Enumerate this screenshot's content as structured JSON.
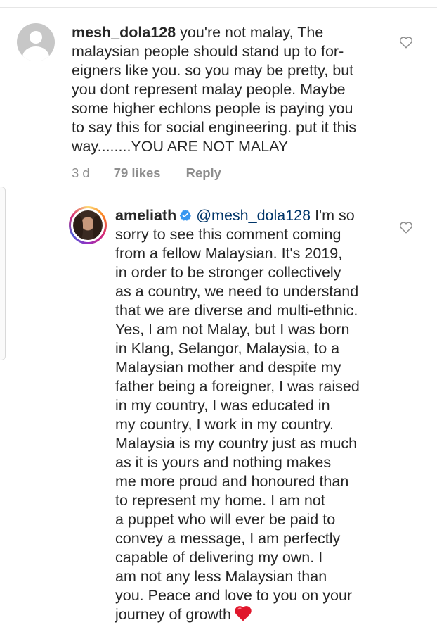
{
  "comments": [
    {
      "username": "mesh_dola128",
      "lines": [
        " you're not malay, The",
        "malaysian people should stand up to for-",
        "eigners like you. so you may be pretty, but",
        "you dont represent malay people. Maybe",
        "some higher echlons people is paying you",
        "to say this for social engineering. put it this",
        "way........YOU ARE NOT MALAY"
      ],
      "time": "3 d",
      "likes": "79 likes",
      "reply_label": "Reply",
      "avatar": "default-avatar-icon",
      "like_icon": "heart-outline-icon"
    },
    {
      "username": "ameliath",
      "verified": true,
      "mention": "@mesh_dola128",
      "first_line_rest": " I'm so",
      "lines": [
        "sorry to see this comment coming",
        "from a fellow Malaysian. It's 2019,",
        "in order to be stronger collectively",
        "as a country, we need to understand",
        "that we are diverse and multi-ethnic.",
        "Yes, I am not Malay, but I was born",
        "in Klang, Selangor, Malaysia, to a",
        "Malaysian mother and despite my",
        "father being a foreigner, I was raised",
        "in my country, I was educated in",
        "my country, I work in my country.",
        "Malaysia is my country just as much",
        "as it is yours and nothing makes",
        "me more proud and honoured than",
        "to represent my home. I am not",
        "a puppet who will ever be paid to",
        "convey a message, I am perfectly",
        "capable of delivering my own. I",
        "am not any less Malaysian than",
        "you. Peace and love to you on your"
      ],
      "last_line": "journey of growth",
      "emoji": "red-heart-emoji",
      "avatar": "profile-photo-with-story-ring",
      "like_icon": "heart-outline-icon"
    }
  ],
  "colors": {
    "text": "#262626",
    "meta": "#8e8e8e",
    "mention": "#003569",
    "verified": "#3897f0",
    "heart_emoji": "#e0162b"
  }
}
